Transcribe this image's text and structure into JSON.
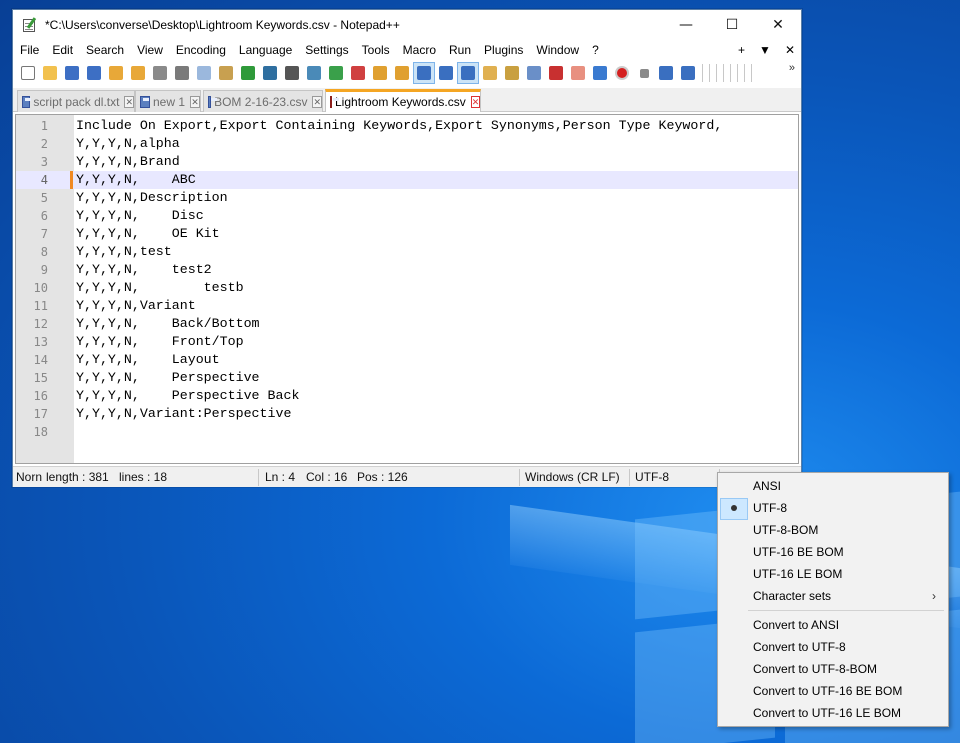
{
  "window": {
    "title": "*C:\\Users\\converse\\Desktop\\Lightroom Keywords.csv - Notepad++",
    "controls": {
      "minimize": "—",
      "maximize": "☐",
      "close": "✕"
    }
  },
  "menu": {
    "items": [
      "File",
      "Edit",
      "Search",
      "View",
      "Encoding",
      "Language",
      "Settings",
      "Tools",
      "Macro",
      "Run",
      "Plugins",
      "Window",
      "?"
    ],
    "right": {
      "plus": "+",
      "down": "▼",
      "close": "✕"
    }
  },
  "toolbar": {
    "more": "»",
    "icons": [
      "new-file",
      "open-file",
      "save",
      "save-all",
      "close",
      "close-all",
      "print",
      "cut",
      "copy",
      "paste",
      "undo",
      "redo",
      "find",
      "replace",
      "zoom-in",
      "zoom-out",
      "sync-vertical",
      "sync-horizontal",
      "word-wrap",
      "show-all-chars",
      "indent-guide",
      "udl",
      "doc-map",
      "doc-list",
      "function-list",
      "folder-workspace",
      "monitor",
      "record-macro",
      "stop-record",
      "play-macro",
      "run-macro-multiple"
    ]
  },
  "tabs": [
    {
      "label": "script pack dl.txt",
      "active": false
    },
    {
      "label": "new 1",
      "active": false
    },
    {
      "label": "BOM 2-16-23.csv",
      "active": false
    },
    {
      "label": "Lightroom Keywords.csv",
      "active": true
    }
  ],
  "editor": {
    "current_line": 4,
    "lines": [
      {
        "n": "1",
        "text": "Include On Export,Export Containing Keywords,Export Synonyms,Person Type Keyword,"
      },
      {
        "n": "2",
        "text": "Y,Y,Y,N,alpha"
      },
      {
        "n": "3",
        "text": "Y,Y,Y,N,Brand"
      },
      {
        "n": "4",
        "text": "Y,Y,Y,N,    ABC"
      },
      {
        "n": "5",
        "text": "Y,Y,Y,N,Description"
      },
      {
        "n": "6",
        "text": "Y,Y,Y,N,    Disc"
      },
      {
        "n": "7",
        "text": "Y,Y,Y,N,    OE Kit"
      },
      {
        "n": "8",
        "text": "Y,Y,Y,N,test"
      },
      {
        "n": "9",
        "text": "Y,Y,Y,N,    test2"
      },
      {
        "n": "10",
        "text": "Y,Y,Y,N,        testb"
      },
      {
        "n": "11",
        "text": "Y,Y,Y,N,Variant"
      },
      {
        "n": "12",
        "text": "Y,Y,Y,N,    Back/Bottom"
      },
      {
        "n": "13",
        "text": "Y,Y,Y,N,    Front/Top"
      },
      {
        "n": "14",
        "text": "Y,Y,Y,N,    Layout"
      },
      {
        "n": "15",
        "text": "Y,Y,Y,N,    Perspective"
      },
      {
        "n": "16",
        "text": "Y,Y,Y,N,    Perspective Back"
      },
      {
        "n": "17",
        "text": "Y,Y,Y,N,Variant:Perspective"
      },
      {
        "n": "18",
        "text": ""
      }
    ]
  },
  "status": {
    "type": "Norn",
    "length": "length : 381",
    "lines": "lines : 18",
    "ln": "Ln : 4",
    "col": "Col : 16",
    "pos": "Pos : 126",
    "eol": "Windows (CR LF)",
    "encoding": "UTF-8"
  },
  "encoding_menu": {
    "items": [
      "ANSI",
      "UTF-8",
      "UTF-8-BOM",
      "UTF-16 BE BOM",
      "UTF-16 LE BOM",
      "Character sets"
    ],
    "selected": "UTF-8",
    "submenu_arrow": "›",
    "convert_items": [
      "Convert to ANSI",
      "Convert to UTF-8",
      "Convert to UTF-8-BOM",
      "Convert to UTF-16 BE BOM",
      "Convert to UTF-16 LE BOM"
    ]
  }
}
